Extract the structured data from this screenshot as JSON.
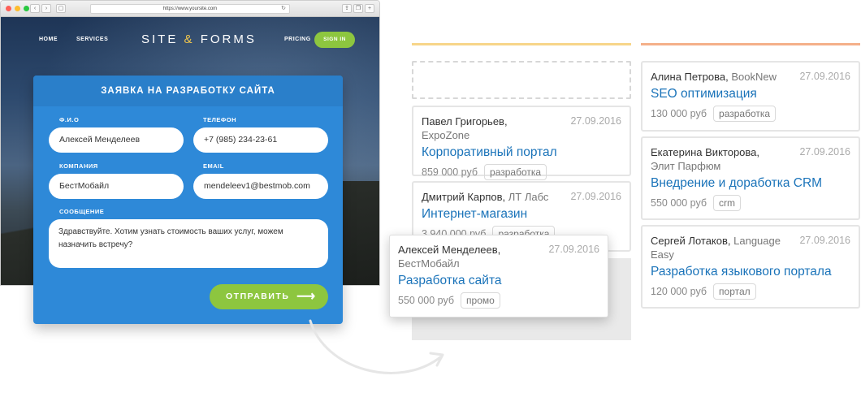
{
  "browser": {
    "url": "https://www.yoursite.com",
    "traffic_lights": [
      "#ff5f57",
      "#febc2e",
      "#28c840"
    ]
  },
  "site": {
    "nav": {
      "home": "HOME",
      "services": "SERVICES",
      "logo_left": "SITE",
      "logo_amp": "&",
      "logo_right": "FORMS",
      "pricing": "PRICING",
      "sign_in": "SIGN IN"
    }
  },
  "form": {
    "title": "ЗАЯВКА НА РАЗРАБОТКУ САЙТА",
    "name_label": "Ф.И.О",
    "name_value": "Алексей Менделеев",
    "phone_label": "ТЕЛЕФОН",
    "phone_value": "+7 (985) 234-23-61",
    "company_label": "КОМПАНИЯ",
    "company_value": "БестМобайл",
    "email_label": "EMAIL",
    "email_value": "mendeleev1@bestmob.com",
    "message_label": "СООБЩЕНИЕ",
    "message_value": "Здравствуйте. Хотим узнать стоимость ваших услуг, можем назначить встречу?",
    "submit_label": "ОТПРАВИТЬ",
    "submit_arrow": "⟶"
  },
  "colors": {
    "col1_accent": "#f7d58a",
    "col2_accent": "#f4b08a",
    "brand_blue": "#2e89d8",
    "brand_green": "#8dc63f",
    "link_blue": "#1a73b9"
  },
  "board": {
    "column1": [
      {
        "person": "Павел Григорьев",
        "company": "ExpoZone",
        "date": "27.09.2016",
        "title": "Корпоративный портал",
        "price": "859 000 руб",
        "tag": "разработка"
      },
      {
        "person": "Дмитрий Карпов",
        "company": "ЛТ Лабс",
        "date": "27.09.2016",
        "title": "Интернет-магазин",
        "price": "3 940 000 руб",
        "tag": "разработка"
      }
    ],
    "dragging": {
      "person": "Алексей Менделеев",
      "company": "БестМобайл",
      "date": "27.09.2016",
      "title": "Разработка сайта",
      "price": "550 000 руб",
      "tag": "промо"
    },
    "column2": [
      {
        "person": "Алина Петрова",
        "company": "BookNew",
        "date": "27.09.2016",
        "title": "SEO оптимизация",
        "price": "130 000 руб",
        "tag": "разработка"
      },
      {
        "person": "Екатерина Викторова",
        "company": "Элит Парфюм",
        "date": "27.09.2016",
        "title": "Внедрение и доработка CRM",
        "price": "550 000 руб",
        "tag": "crm"
      },
      {
        "person": "Сергей Лотаков",
        "company": "Language Easy",
        "date": "27.09.2016",
        "title": "Разработка языкового портала",
        "price": "120 000 руб",
        "tag": "портал"
      }
    ]
  }
}
